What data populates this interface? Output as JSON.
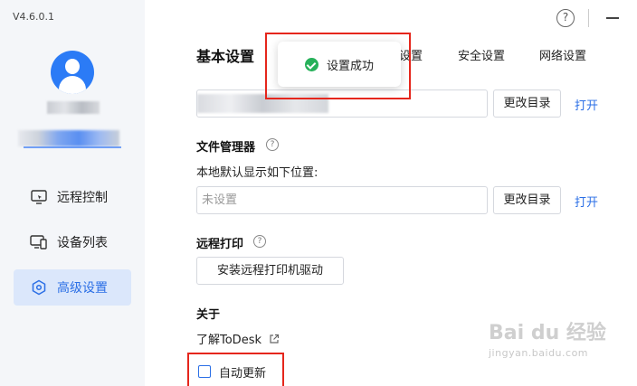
{
  "app": {
    "version": "V4.6.0.1"
  },
  "sidebar": {
    "items": [
      {
        "label": "远程控制",
        "icon": "monitor-icon",
        "active": false
      },
      {
        "label": "设备列表",
        "icon": "devices-icon",
        "active": false
      },
      {
        "label": "高级设置",
        "icon": "hexagon-settings-icon",
        "active": true
      }
    ]
  },
  "header": {
    "help_symbol": "?"
  },
  "tabs": {
    "title": "基本设置",
    "items": [
      "设置",
      "安全设置",
      "网络设置"
    ]
  },
  "toast": {
    "message": "设置成功",
    "icon": "check-circle-icon",
    "color": "#27b15a"
  },
  "storage": {
    "change_label": "更改目录",
    "open_label": "打开"
  },
  "file_manager": {
    "title": "文件管理器",
    "description": "本地默认显示如下位置:",
    "placeholder": "未设置",
    "change_label": "更改目录",
    "open_label": "打开"
  },
  "remote_print": {
    "title": "远程打印",
    "install_button": "安装远程打印机驱动"
  },
  "about": {
    "title": "关于",
    "learn_link": "了解ToDesk",
    "auto_update_label": "自动更新",
    "auto_update_checked": false
  },
  "watermark": {
    "text": "Bai du 经验",
    "sub": "jingyan.baidu.com"
  },
  "colors": {
    "accent": "#2b6fe6",
    "highlight": "#e5261c"
  }
}
